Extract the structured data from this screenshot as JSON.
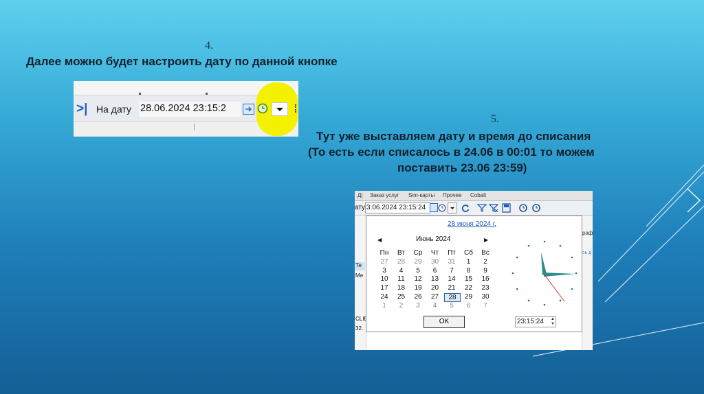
{
  "step4": {
    "number": "4.",
    "text": "Далее можно будет настроить дату по данной кнопке"
  },
  "step5": {
    "number": "5.",
    "line1": "Тут уже выставляем дату и время до списания",
    "line2": "(То есть если списалось в 24.06 в 00:01 то можем",
    "line3": "поставить 23.06 23:59)"
  },
  "toolbar_small": {
    "chevron": ">|",
    "label": "На дату",
    "datetime": "28.06.2024 23:15:2"
  },
  "toolbar_large": {
    "tabs": [
      "Заказ услуг",
      "Sim-карты",
      "Прочее",
      "Cobalt"
    ],
    "label": "ату",
    "datetime": "3.06.2024 23:15:24"
  },
  "calendar": {
    "today_link": "28 июня 2024 г.",
    "month": "Июнь 2024",
    "weekdays": [
      "Пн",
      "Вт",
      "Ср",
      "Чт",
      "Пт",
      "Сб",
      "Вс"
    ],
    "weeks": [
      [
        "27",
        "28",
        "29",
        "30",
        "31",
        "1",
        "2"
      ],
      [
        "3",
        "4",
        "5",
        "6",
        "7",
        "8",
        "9"
      ],
      [
        "10",
        "11",
        "12",
        "13",
        "14",
        "15",
        "16"
      ],
      [
        "17",
        "18",
        "19",
        "20",
        "21",
        "22",
        "23"
      ],
      [
        "24",
        "25",
        "26",
        "27",
        "28",
        "29",
        "30"
      ],
      [
        "1",
        "2",
        "3",
        "4",
        "5",
        "6",
        "7"
      ]
    ],
    "selected_day": "28",
    "ok_label": "OK",
    "time_value": "23:15:24"
  },
  "side_fragments": {
    "right_label": "рафи",
    "right_label2": "сь д",
    "left1": "Те",
    "left2": "Ме",
    "left3": "CLIE",
    "left4": "32."
  },
  "colors": {
    "highlight": "#f3f000",
    "link": "#1f5fb8",
    "bg_top": "#5fd0ee",
    "bg_bottom": "#145f96"
  }
}
